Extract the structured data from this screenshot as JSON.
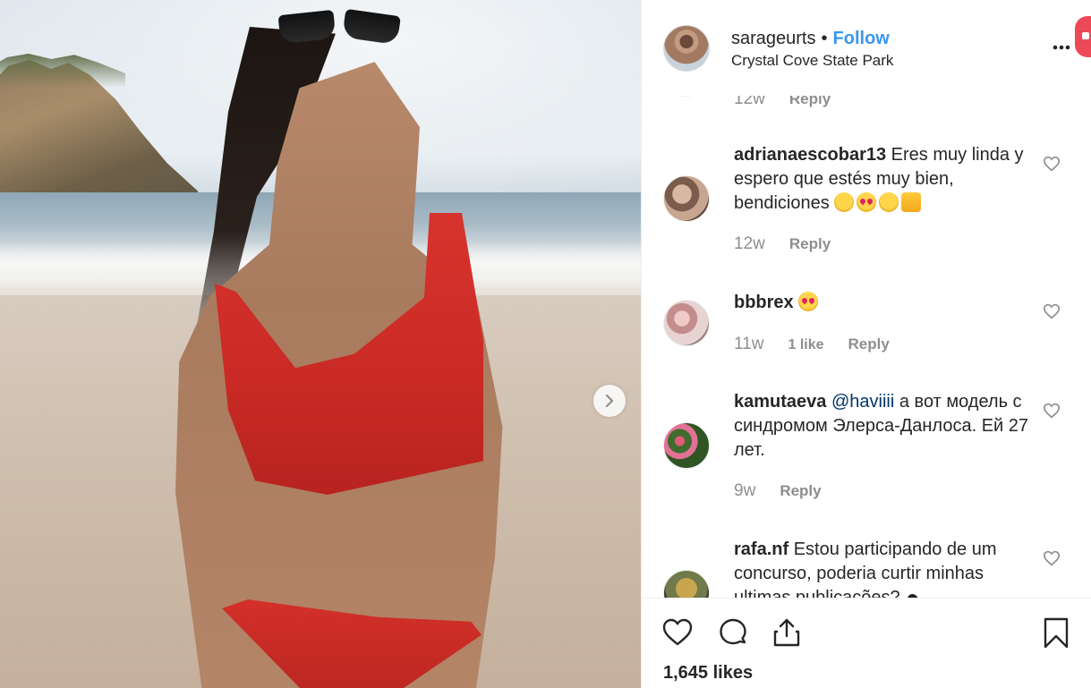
{
  "post": {
    "username": "sarageurts",
    "separator": "•",
    "follow_label": "Follow",
    "location": "Crystal Cove State Park",
    "likes_text": "1,645 likes"
  },
  "comments": [
    {
      "user": "",
      "text": "",
      "time": "12w",
      "reply": "Reply",
      "likes": ""
    },
    {
      "user": "adrianaescobar13",
      "text": "Eres muy linda y espero que estés muy bien, bendiciones",
      "emojis": [
        "wink-kiss-emoji",
        "heart-eyes-emoji",
        "yum-emoji",
        "thumbs-up-emoji"
      ],
      "time": "12w",
      "reply": "Reply",
      "likes": ""
    },
    {
      "user": "bbbrex",
      "text": "",
      "emojis": [
        "heart-eyes-emoji"
      ],
      "time": "11w",
      "reply": "Reply",
      "likes": "1 like"
    },
    {
      "user": "kamutaeva",
      "mention": "@haviiii",
      "text": "а вот модель с синдромом Элерса-Данлоса. Ей 27 лет.",
      "time": "9w",
      "reply": "Reply",
      "likes": ""
    },
    {
      "user": "rafa.nf",
      "text": "Estou participando de um concurso, poderia curtir minhas ultimas publicações?",
      "emojis": [
        "black-heart-emoji"
      ],
      "time": "",
      "reply": "",
      "likes": ""
    }
  ],
  "icons": {
    "more": "more-horizontal-icon",
    "next": "chevron-right-icon",
    "like": "heart-outline-icon",
    "comment": "comment-bubble-icon",
    "share": "share-upload-icon",
    "save": "bookmark-icon",
    "comment_like": "small-heart-icon"
  },
  "colors": {
    "accent": "#3897f0",
    "text": "#262626",
    "muted": "#8e8e8e",
    "mention": "#003569",
    "notification": "#ed4956"
  }
}
